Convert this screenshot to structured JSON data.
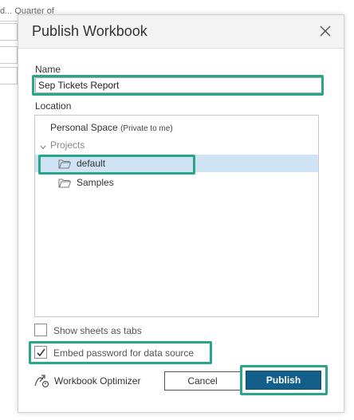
{
  "background": {
    "header_text": "d...  Quarter of"
  },
  "dialog": {
    "title": "Publish Workbook",
    "name_label": "Name",
    "name_value": "Sep Tickets Report",
    "location_label": "Location",
    "tree": {
      "personal_space": "Personal Space",
      "personal_space_note": "(Private to me)",
      "projects": "Projects",
      "folders": [
        "default",
        "Samples"
      ],
      "selected": "default"
    },
    "show_sheets_label": "Show sheets as tabs",
    "show_sheets_checked": false,
    "embed_password_label": "Embed password for data source",
    "embed_password_checked": true,
    "optimizer_label": "Workbook Optimizer",
    "cancel_label": "Cancel",
    "publish_label": "Publish"
  },
  "colors": {
    "accent": "#12608a",
    "highlight": "#2aa58a",
    "selection": "#cfe3f5"
  },
  "icons": [
    "close-icon",
    "chevron-down-icon",
    "folder-icon",
    "workbook-optimizer-icon",
    "checkmark-icon"
  ]
}
